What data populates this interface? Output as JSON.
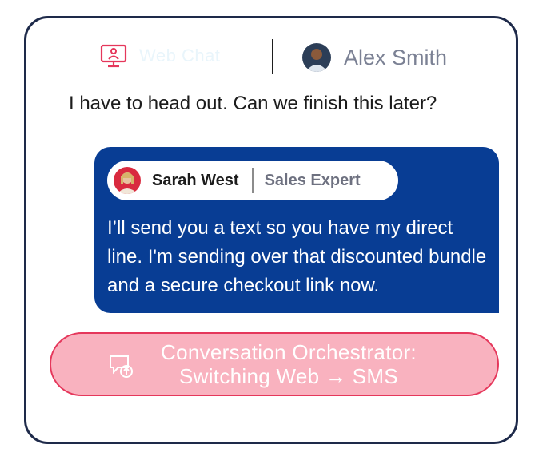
{
  "header": {
    "channel_icon": "web-chat-monitor-icon",
    "channel_label": "Web Chat",
    "customer_name": "Alex Smith"
  },
  "customer_message": "I have to head out. Can we finish this later?",
  "agent": {
    "name": "Sarah West",
    "role": "Sales Expert",
    "message": "I’ll send you a text so you have my direct line. I'm sending over that discounted bundle and a secure checkout link now."
  },
  "orchestrator": {
    "icon": "chat-switch-icon",
    "line1": "Conversation Orchestrator:",
    "line2": "Switching Web → SMS"
  },
  "colors": {
    "border": "#1e2a4a",
    "bubble": "#083d94",
    "accent": "#e5375b",
    "pill": "#f9b2bf"
  }
}
